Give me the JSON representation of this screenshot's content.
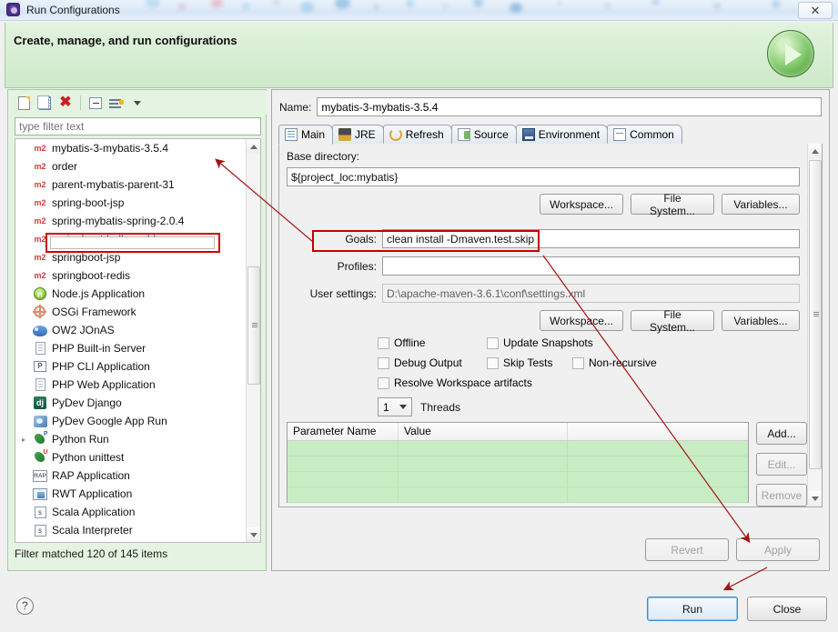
{
  "window": {
    "title": "Run Configurations",
    "icon": "eclipse-icon",
    "close_label": "✕"
  },
  "banner": {
    "title": "Create, manage, and run configurations",
    "icon": "run-play-icon"
  },
  "left_panel": {
    "toolbar": [
      {
        "name": "new-launch-configuration-icon",
        "label": ""
      },
      {
        "name": "duplicate-configuration-icon",
        "label": ""
      },
      {
        "name": "delete-configuration-icon",
        "label": "✖"
      },
      {
        "name": "collapse-all-icon",
        "label": ""
      },
      {
        "name": "filter-configurations-icon",
        "label": ""
      },
      {
        "name": "view-menu-chevron-icon",
        "label": ""
      }
    ],
    "filter": {
      "placeholder": "type filter text",
      "value": ""
    },
    "tree_items": [
      {
        "icon": "m2",
        "label": "mybatis-3-mybatis-3.5.4",
        "selected": true,
        "twisty": ""
      },
      {
        "icon": "m2",
        "label": "order",
        "selected": false,
        "twisty": ""
      },
      {
        "icon": "m2",
        "label": "parent-mybatis-parent-31",
        "selected": false,
        "twisty": ""
      },
      {
        "icon": "m2",
        "label": "spring-boot-jsp",
        "selected": false,
        "twisty": ""
      },
      {
        "icon": "m2",
        "label": "spring-mybatis-spring-2.0.4",
        "selected": false,
        "twisty": ""
      },
      {
        "icon": "m2",
        "label": "springboot-helloworld",
        "selected": false,
        "twisty": ""
      },
      {
        "icon": "m2",
        "label": "springboot-jsp",
        "selected": false,
        "twisty": ""
      },
      {
        "icon": "m2",
        "label": "springboot-redis",
        "selected": false,
        "twisty": ""
      },
      {
        "icon": "nodejs",
        "label": "Node.js Application",
        "selected": false,
        "twisty": ""
      },
      {
        "icon": "osgi",
        "label": "OSGi Framework",
        "selected": false,
        "twisty": ""
      },
      {
        "icon": "ow2",
        "label": "OW2 JOnAS",
        "selected": false,
        "twisty": ""
      },
      {
        "icon": "php",
        "label": "PHP Built-in Server",
        "selected": false,
        "twisty": ""
      },
      {
        "icon": "phpcli",
        "label": "PHP CLI Application",
        "selected": false,
        "twisty": ""
      },
      {
        "icon": "php",
        "label": "PHP Web Application",
        "selected": false,
        "twisty": ""
      },
      {
        "icon": "django",
        "label": "PyDev Django",
        "selected": false,
        "twisty": ""
      },
      {
        "icon": "pygae",
        "label": "PyDev Google App Run",
        "selected": false,
        "twisty": ""
      },
      {
        "icon": "python",
        "label": "Python Run",
        "selected": false,
        "twisty": "▸"
      },
      {
        "icon": "pythonu",
        "label": "Python unittest",
        "selected": false,
        "twisty": ""
      },
      {
        "icon": "rap",
        "label": "RAP Application",
        "selected": false,
        "twisty": ""
      },
      {
        "icon": "rwt",
        "label": "RWT Application",
        "selected": false,
        "twisty": ""
      },
      {
        "icon": "scala",
        "label": "Scala Application",
        "selected": false,
        "twisty": ""
      },
      {
        "icon": "scala",
        "label": "Scala Interpreter",
        "selected": false,
        "twisty": ""
      }
    ],
    "status": "Filter matched 120 of 145 items"
  },
  "right_panel": {
    "name_label": "Name:",
    "name_value": "mybatis-3-mybatis-3.5.4",
    "tabs": [
      {
        "label": "Main",
        "icon": "main-tab-icon",
        "active": true
      },
      {
        "label": "JRE",
        "icon": "jre-tab-icon",
        "active": false
      },
      {
        "label": "Refresh",
        "icon": "refresh-tab-icon",
        "active": false
      },
      {
        "label": "Source",
        "icon": "source-tab-icon",
        "active": false
      },
      {
        "label": "Environment",
        "icon": "environment-tab-icon",
        "active": false
      },
      {
        "label": "Common",
        "icon": "common-tab-icon",
        "active": false
      }
    ],
    "main_tab": {
      "base_directory_label": "Base directory:",
      "base_directory_value": "${project_loc:mybatis}",
      "browse_row_1": [
        "Workspace...",
        "File System...",
        "Variables..."
      ],
      "goals_label": "Goals:",
      "goals_value": "clean install -Dmaven.test.skip",
      "profiles_label": "Profiles:",
      "profiles_value": "",
      "user_settings_label": "User settings:",
      "user_settings_value": "D:\\apache-maven-3.6.1\\conf\\settings.xml",
      "browse_row_2": [
        "Workspace...",
        "File System...",
        "Variables..."
      ],
      "checkboxes": [
        {
          "label": "Offline",
          "checked": false
        },
        {
          "label": "Update Snapshots",
          "checked": false
        },
        {
          "label": "Debug Output",
          "checked": false
        },
        {
          "label": "Skip Tests",
          "checked": false
        },
        {
          "label": "Non-recursive",
          "checked": false
        },
        {
          "label": "Resolve Workspace artifacts",
          "checked": false
        }
      ],
      "threads_value": "1",
      "threads_label": "Threads",
      "parameter_table": {
        "columns": [
          "Parameter Name",
          "Value",
          ""
        ],
        "rows": [
          [
            "",
            "",
            ""
          ],
          [
            "",
            "",
            ""
          ],
          [
            "",
            "",
            ""
          ],
          [
            "",
            "",
            ""
          ]
        ]
      },
      "side_buttons": [
        {
          "label": "Add...",
          "enabled": true
        },
        {
          "label": "Edit...",
          "enabled": false
        },
        {
          "label": "Remove",
          "enabled": false
        }
      ]
    },
    "revert_label": "Revert",
    "apply_label": "Apply"
  },
  "footer": {
    "help_label": "?",
    "run_label": "Run",
    "close_label": "Close"
  },
  "colors": {
    "accent_green": "#cfe9cb",
    "annotation_red": "#c30000",
    "focus_blue": "#3c8ec4",
    "table_row_green": "#c8ecc3"
  }
}
